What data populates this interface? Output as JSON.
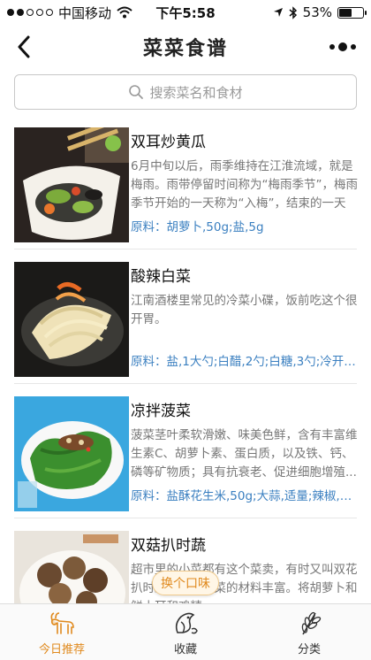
{
  "status_bar": {
    "carrier": "中国移动",
    "time": "下午5:58",
    "battery": "53%",
    "battery_level": 0.53,
    "icons": [
      "signal-dots-icon",
      "wifi-icon",
      "location-arrow-icon",
      "bluetooth-icon",
      "battery-icon"
    ]
  },
  "nav": {
    "title": "菜菜食谱",
    "back_icon": "chevron-left-icon",
    "more_icon": "more-dots-icon"
  },
  "search": {
    "placeholder": "搜索菜名和食材",
    "icon": "search-icon"
  },
  "recipes": [
    {
      "title": "双耳炒黄瓜",
      "desc": "6月中旬以后，雨季维持在江淮流域，就是梅雨。雨带停留时间称为“梅雨季节”，梅雨季节开始的一天称为“入梅”，结束的一天称...",
      "ingredients": "原料：胡萝卜,50g;盐,5g"
    },
    {
      "title": "酸辣白菜",
      "desc": "江南酒楼里常见的冷菜小碟，饭前吃这个很开胃。",
      "ingredients": "原料：盐,1大勺;白醋,2勺;白糖,3勺;冷开水,..."
    },
    {
      "title": "凉拌菠菜",
      "desc": "菠菜茎叶柔软滑嫩、味美色鲜，含有丰富维生素C、胡萝卜素、蛋白质，以及铁、钙、磷等矿物质；具有抗衰老、促进细胞增殖...",
      "ingredients": "原料：盐酥花生米,50g;大蒜,适量;辣椒,适..."
    },
    {
      "title": "双菇扒时蔬",
      "desc": "超市里的小菜都有这个菜卖，有时又叫双花扒时蔬，这道素菜的材料丰富。将胡萝卜和鲜木耳和鸡精...",
      "ingredients": ""
    }
  ],
  "float_button": {
    "label": "换个口味"
  },
  "tabbar": {
    "active_color": "#e08a1e",
    "tabs": [
      {
        "label": "今日推荐",
        "icon": "goat-icon"
      },
      {
        "label": "收藏",
        "icon": "fish-icon"
      },
      {
        "label": "分类",
        "icon": "wheat-icon"
      }
    ]
  }
}
